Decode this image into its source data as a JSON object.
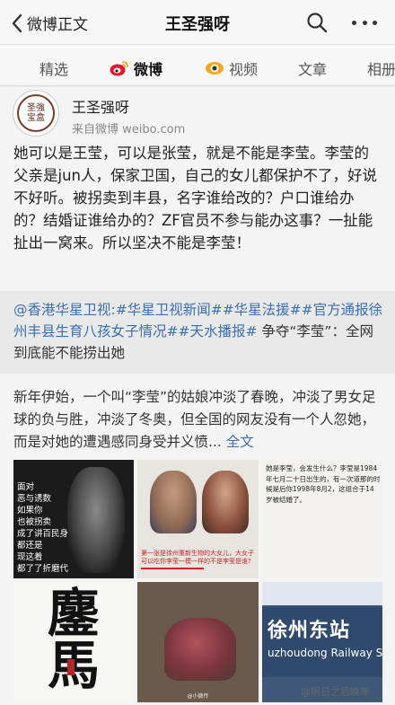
{
  "topbar": {
    "back_label": "微博正文",
    "title": "王圣强呀"
  },
  "tabs": [
    {
      "label": "精选",
      "active": false
    },
    {
      "label": "微博",
      "active": true,
      "icon": "weibo-icon"
    },
    {
      "label": "视频",
      "active": false,
      "icon": "video-icon"
    },
    {
      "label": "文章",
      "active": false
    },
    {
      "label": "相册",
      "active": false
    }
  ],
  "post": {
    "author": "王圣强呀",
    "source": "来自微博 weibo.com",
    "text": "她可以是王莹，可以是张莹，就是不能是李莹。李莹的父亲是jun人，保家卫国，自己的女儿都保护不了，好说不好听。被拐卖到丰县，名字谁给改的？户口谁给办的？结婚证谁给办的？ZF官员不参与能办这事？一扯能扯出一窝来。所以坚决不能是李莹！"
  },
  "repost": {
    "links": "@香港华星卫视:#华星卫视新闻##华星法援##官方通报徐州丰县生育八孩女子情况##天水播报#",
    "text": " 争夺“李莹”：全网到底能不能捞出她"
  },
  "article": {
    "text": "新年伊始，一个叫“李莹”的姑娘冲淡了春晚，冲淡了男女足球的负与胜，冲淡了冬奥，但全国的网友没有一个人忽她，而是对她的遭遇感同身受并义愤...",
    "more_label": "全文"
  },
  "images": {
    "img1_lines": [
      "面对",
      "恶与诱数",
      "如果你",
      "也被拐卖",
      "成了讲百民身",
      "都还是",
      "现这着",
      "都了了折磨代"
    ],
    "img2_caption": "第一张是徐州重新生物的大女儿，大女子可以吃你李莹一模一样的不是李莹是谁?",
    "img3_text": "她是李莹，会发生什么？李莹是1984年七月二十日出生的，有一次道那的时候是后你1998年8月2，这组合于14岁被结婚了。",
    "img4_glyph": "鏖",
    "img5_mark": "@小微传",
    "img6_cn": "徐州东站",
    "img6_en": "uzhoudong Railway Station"
  },
  "watermark": "@明日之后晚年",
  "colors": {
    "link": "#3a6fb0",
    "weibo_red": "#e6162d",
    "accent_orange": "#f5a623"
  }
}
